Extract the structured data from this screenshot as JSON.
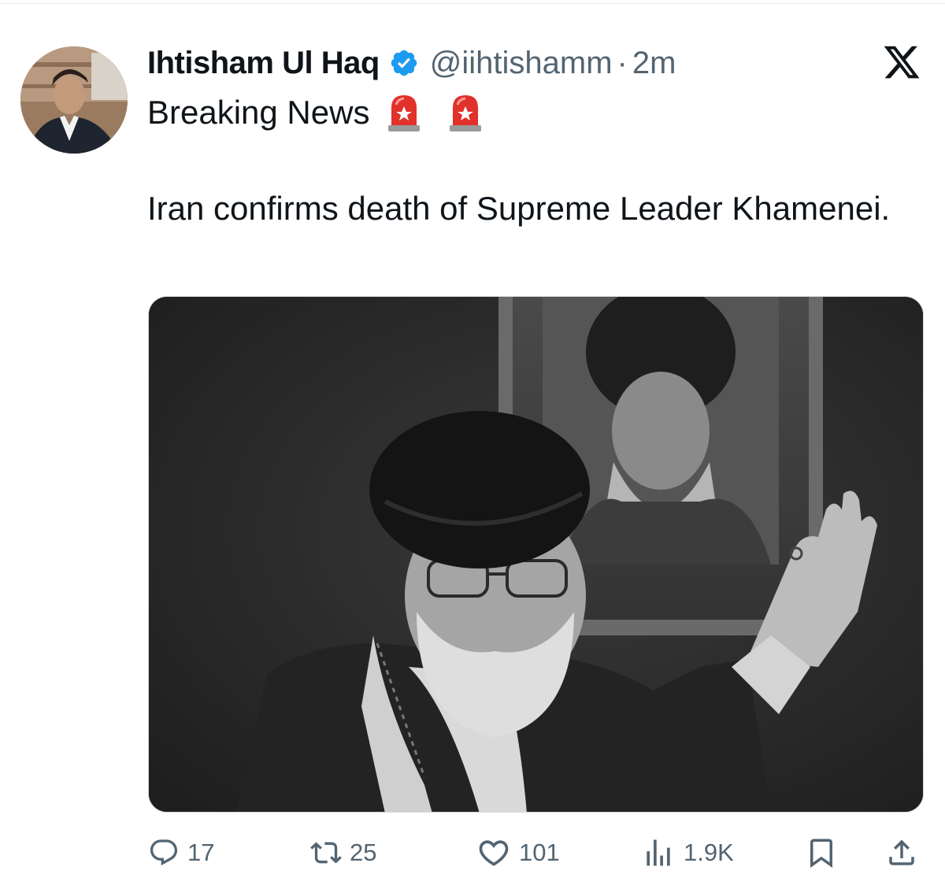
{
  "post": {
    "author": {
      "display_name": "Ihtisham Ul Haq",
      "handle": "@iihtishamm",
      "verified": true
    },
    "separator": "·",
    "time": "2m",
    "subtitle": "Breaking News",
    "emojis": [
      "siren-icon",
      "siren-icon"
    ],
    "text": "Iran confirms death of Supreme Leader Khamenei.",
    "media": {
      "type": "photo",
      "alt": ""
    }
  },
  "actions": {
    "reply_count": "17",
    "retweet_count": "25",
    "like_count": "101",
    "views_count": "1.9K"
  },
  "icons": {
    "brand": "x-logo-icon",
    "verified": "verified-badge-icon",
    "reply": "reply-icon",
    "retweet": "retweet-icon",
    "like": "heart-icon",
    "views": "views-icon",
    "bookmark": "bookmark-icon",
    "share": "share-icon"
  },
  "colors": {
    "text_primary": "#0f1419",
    "text_secondary": "#536471",
    "verified_blue": "#1d9bf0",
    "siren_red": "#e0312b"
  }
}
